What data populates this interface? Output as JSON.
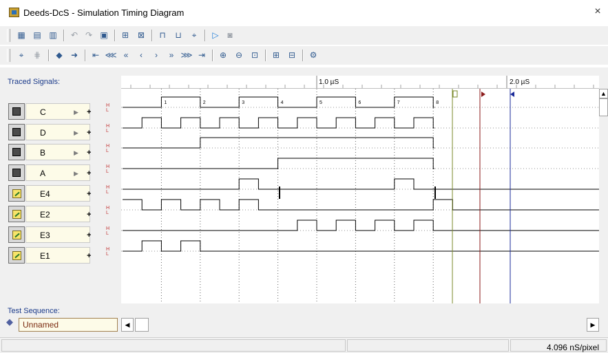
{
  "window": {
    "title": "Deeds-DcS  -  Simulation Timing Diagram",
    "close_glyph": "×"
  },
  "panels": {
    "traced_signals_label": "Traced Signals:",
    "test_sequence_label": "Test Sequence:",
    "test_sequence_value": "Unnamed"
  },
  "signals": [
    {
      "name": "C",
      "kind": "input"
    },
    {
      "name": "D",
      "kind": "input"
    },
    {
      "name": "B",
      "kind": "input"
    },
    {
      "name": "A",
      "kind": "input"
    },
    {
      "name": "E4",
      "kind": "output"
    },
    {
      "name": "E2",
      "kind": "output"
    },
    {
      "name": "E3",
      "kind": "output"
    },
    {
      "name": "E1",
      "kind": "output"
    }
  ],
  "level_labels": {
    "high": "H",
    "low": "L"
  },
  "ruler": {
    "marks": [
      "1.0 µS",
      "2.0 µS"
    ]
  },
  "step_labels": [
    "1",
    "2",
    "3",
    "4",
    "5",
    "6",
    "7",
    "8"
  ],
  "status": {
    "resolution": "4.096 nS/pixel"
  },
  "colors": {
    "cursor_green": "#7a8a2a",
    "cursor_red": "#8b1a1a",
    "cursor_blue": "#1a2a9a",
    "title_blue": "#1a3a8a"
  }
}
